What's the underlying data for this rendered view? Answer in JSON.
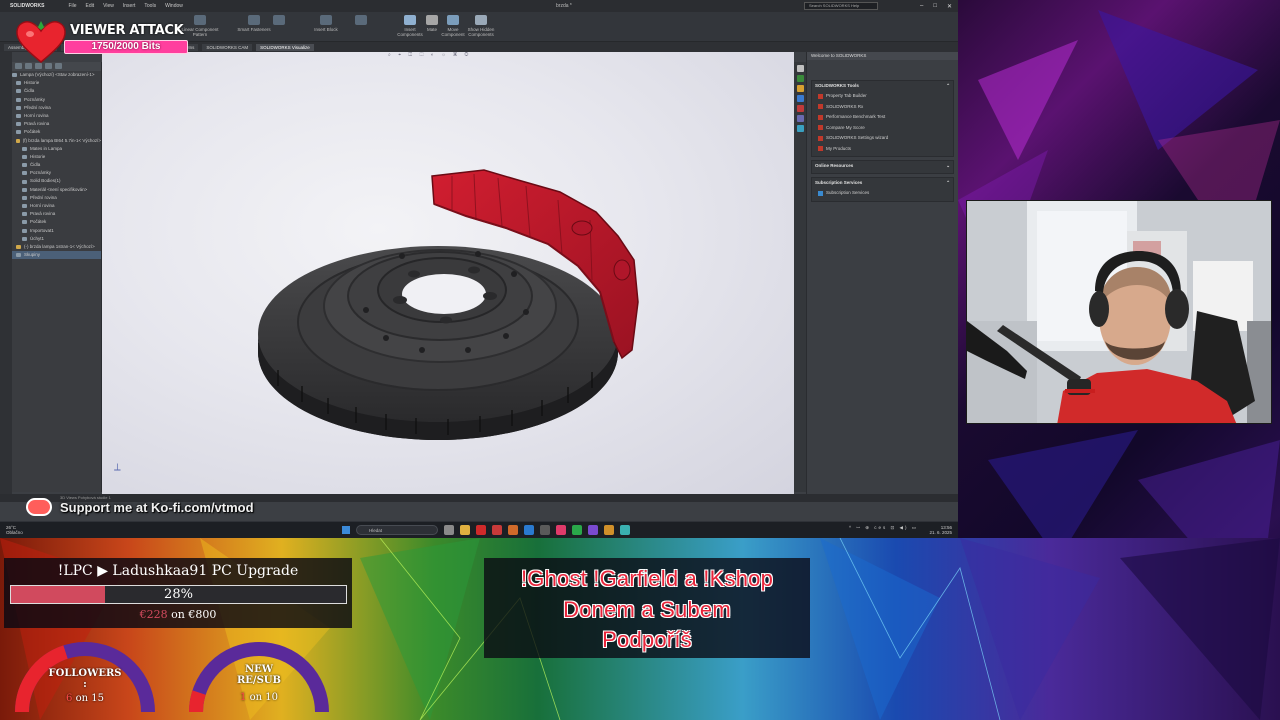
{
  "solidworks": {
    "logo": "SOLIDWORKS",
    "menu": [
      "File",
      "Edit",
      "View",
      "Insert",
      "Tools",
      "Window"
    ],
    "doc_title": "brzda *",
    "search_placeholder": "Search SOLIDWORKS Help",
    "ribbon": [
      {
        "label": "Insert Components"
      },
      {
        "label": "Mate"
      },
      {
        "label": "Move Component"
      },
      {
        "label": "Show Hidden Components"
      },
      {
        "label": "Linear Component Pattern"
      },
      {
        "label": "Smart Fasteners"
      },
      {
        "label": "Assembly Features"
      },
      {
        "label": "Reference Geometry"
      },
      {
        "label": "Bill of Materials"
      },
      {
        "label": "Exploded View"
      },
      {
        "label": "Insert Block"
      }
    ],
    "tabs": [
      "Assembly",
      "Layout",
      "Sketch",
      "Markup",
      "Evaluate",
      "SOLIDWORKS Add-Ins",
      "SOLIDWORKS CAM",
      "SOLIDWORKS Visualize"
    ],
    "active_tab": "SOLIDWORKS Visualize",
    "tree": [
      "Lampa (Výchozí) <Stav zobrazení-1>",
      "Historie",
      "Čidla",
      "Poznámky",
      "Přední rovina",
      "Horní rovina",
      "Pravá rovina",
      "Počátek",
      "(f) brzda lampa BI64 5.7in-1< Výchozí>",
      "Mates in Lampa",
      "Historie",
      "Čidla",
      "Poznámky",
      "Solid Bodies(1)",
      "Materiál <není specifikován>",
      "Přední rovina",
      "Horní rovina",
      "Pravá rovina",
      "Počátek",
      "Importovat1",
      "Úchyt1",
      "(-) brzda lampa 1stran-1< Výchozí>",
      "Skupiny"
    ],
    "taskpane": {
      "header": "Welcome to SOLIDWORKS",
      "tools_title": "SOLIDWORKS Tools",
      "tools": [
        "Property Tab Builder",
        "SOLIDWORKS Rx",
        "Performance Benchmark Test",
        "Compare My Score",
        "SOLIDWORKS Settings wizard",
        "My Products"
      ],
      "online_title": "Online Resources",
      "subscription_title": "Subscription Services",
      "subscription_items": [
        "Subscription Services"
      ]
    },
    "status": "3D Views   Pohybová studie 1"
  },
  "taskbar": {
    "weather_temp": "26°C",
    "weather_desc": "Oblačno",
    "search_placeholder": "Hledat",
    "tray": "^ ꟷ ⊕ ces ⊡ ◀) ▭",
    "time": "13:56",
    "date": "21. 6. 2025"
  },
  "overlay": {
    "viewer_attack": {
      "title": "VIEWER ATTACK",
      "bits": "1750/2000 Bits",
      "progress": 0.875
    },
    "kofi_text": "Support me at Ko-fi.com/vtmod",
    "goal": {
      "title": "!LPC ▶ Ladushkaa91 PC Upgrade",
      "percent_label": "28%",
      "percent": 28,
      "current": "€228",
      "target_text": "on €800"
    },
    "followers": {
      "label_line1": "FOLLOWERS",
      "label_line2": ":",
      "value": "6",
      "of_text": "on 15",
      "fraction": 0.4
    },
    "resub": {
      "label_line1": "NEW",
      "label_line2": "RE/SUB",
      "label_line3": ":",
      "value": "1",
      "of_text": "on 10",
      "fraction": 0.1
    },
    "commands": [
      "!Ghost  !Garfield a !Kshop",
      "Donem a Subem",
      "Podpoříš"
    ]
  },
  "colors": {
    "caliper": "#c0182a",
    "disc": "#3a3a3c",
    "accent_pink": "#ff3f9e",
    "goal_fill": "#d14a5e",
    "command_text": "#e8243a"
  }
}
